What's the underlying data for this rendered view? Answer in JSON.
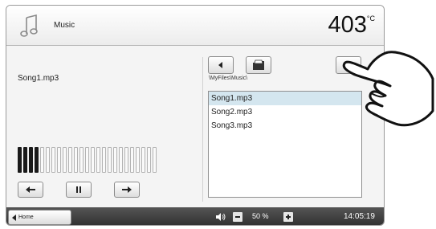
{
  "header": {
    "icon": "music-note-icon",
    "title": "Music",
    "temperature": "403",
    "temperature_unit": "°C"
  },
  "player": {
    "current_song": "Song1.mp3",
    "level_meter": {
      "total_bars": 25,
      "active_bars": 4
    },
    "controls": [
      "previous-arrow-icon",
      "pause-icon",
      "next-arrow-icon"
    ]
  },
  "browser": {
    "path": "\\MyFiles\\Music\\",
    "files": [
      "Song1.mp3",
      "Song2.mp3",
      "Song3.mp3"
    ],
    "selected_index": 0
  },
  "footer": {
    "home_label": "Home",
    "volume": "50 %",
    "time": "14:05:19"
  },
  "colors": {
    "selection": "#d4e6ef",
    "footer_bg": "#3c3c3c",
    "header_bg": "#f2f2f2"
  }
}
